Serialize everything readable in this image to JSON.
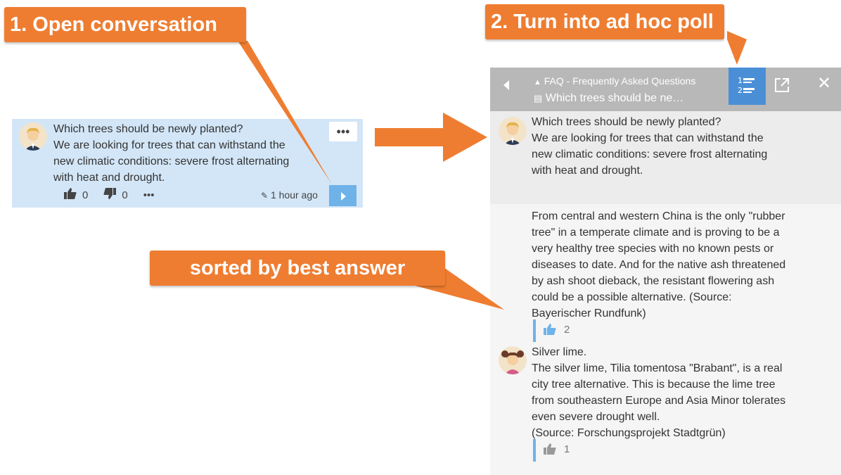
{
  "callouts": {
    "step1": "1. Open conversation",
    "step2": "2. Turn into ad hoc poll",
    "sorted": "sorted by best answer"
  },
  "conversation_card": {
    "title": "Which trees should be newly planted?",
    "body": [
      "We are looking for trees that can withstand the",
      "new climatic conditions: severe frost alternating",
      "with heat and drought."
    ],
    "more_label": "•••",
    "likes": "0",
    "dislikes": "0",
    "actions_more": "•••",
    "time": "1 hour ago",
    "open_icon": "chevron-right-icon"
  },
  "panel": {
    "header": {
      "parent": "FAQ - Frequently Asked Questions",
      "title": "Which trees should be ne…",
      "icons": [
        "back-icon",
        "poll-icon",
        "open-external-icon",
        "close-icon"
      ],
      "accent": "#4a8fd6"
    },
    "question": {
      "lines": [
        "Which trees should be newly planted?",
        "We are looking for trees that can withstand the",
        "new climatic conditions: severe frost alternating",
        "with heat and drought."
      ]
    },
    "answers": [
      {
        "lines": [
          "From central and western China is the only \"rubber",
          "tree\" in a temperate climate and is proving to be a",
          "very healthy tree species with no known pests or",
          "diseases to date. And for the native ash threatened",
          "by ash shoot dieback, the resistant flowering ash",
          "could be a possible alternative. (Source:",
          "Bayerischer Rundfunk)"
        ],
        "likes": "2"
      },
      {
        "lines": [
          "Silver lime.",
          "The silver lime, Tilia tomentosa \"Brabant\", is a real",
          "city tree alternative. This is because the lime tree",
          "from southeastern Europe and Asia Minor tolerates",
          "even severe drought well.",
          "(Source: Forschungsprojekt Stadtgrün)"
        ],
        "likes": "1"
      }
    ]
  },
  "colors": {
    "callout": "#ee7d31",
    "card_bg": "#d3e6f7",
    "header_bg": "#b8b8b8",
    "button_blue": "#6fb2e8"
  }
}
